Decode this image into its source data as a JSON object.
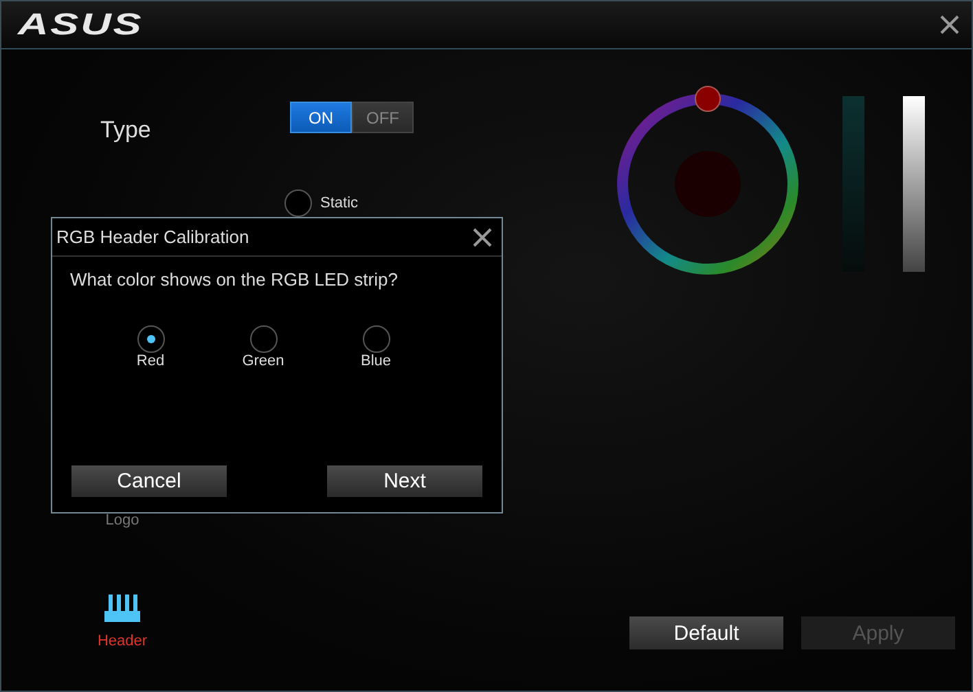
{
  "window": {
    "logo": "ASUS"
  },
  "type_setting": {
    "label": "Type",
    "toggle": [
      {
        "label": "ON",
        "selected": true
      },
      {
        "label": "OFF",
        "selected": false
      }
    ]
  },
  "modes": [
    {
      "label": "Static",
      "selected": false
    }
  ],
  "sidebar": [
    {
      "label": "Logo",
      "selected": false,
      "kind": "plain"
    },
    {
      "label": "Header",
      "selected": true,
      "kind": "header"
    }
  ],
  "dialog": {
    "title": "RGB Header Calibration",
    "question": "What color shows on the RGB LED strip?",
    "options": [
      {
        "label": "Red",
        "selected": true
      },
      {
        "label": "Green",
        "selected": false
      },
      {
        "label": "Blue",
        "selected": false
      }
    ],
    "buttons": [
      "Cancel",
      "Next"
    ]
  },
  "actions": [
    {
      "label": "Default",
      "disabled": false
    },
    {
      "label": "Apply",
      "disabled": true
    }
  ]
}
